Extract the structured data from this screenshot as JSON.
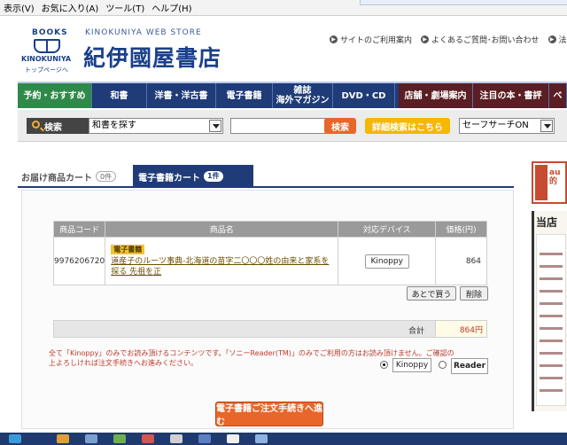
{
  "browser_menu": [
    "表示(V)",
    "お気に入り(A)",
    "ツール(T)",
    "ヘルプ(H)"
  ],
  "logo": {
    "books": "BOOKS",
    "brand": "KINOKUNIYA",
    "top_link": "トップページへ"
  },
  "store": {
    "name_en": "KINOKUNIYA WEB STORE",
    "name_jp": "紀伊國屋書店"
  },
  "header_links": [
    "サイトのご利用案内",
    "よくあるご質問･お問い合わせ",
    "法"
  ],
  "nav": [
    "予約・おすすめ",
    "和書",
    "洋書・洋古書",
    "電子書籍",
    "雑誌\n海外マガジン",
    "DVD・CD",
    "店舗・劇場案内",
    "注目の本・書評",
    "ベ"
  ],
  "search": {
    "label": "検索",
    "category": "和書を探す",
    "query": "",
    "submit": "検索",
    "advanced": "詳細検索はこちら",
    "safe": "セーフサーチON"
  },
  "tabs": {
    "delivery": "お届け商品カート",
    "delivery_count": "0件",
    "ebook": "電子書籍カート",
    "ebook_count": "1件"
  },
  "cart": {
    "headers": {
      "code": "商品コード",
      "name": "商品名",
      "device": "対応デバイス",
      "price": "価格(円)"
    },
    "items": [
      {
        "code": "9976206720",
        "tag": "電子書籍",
        "title": "道産子のルーツ事典-北海道の苗字二〇〇〇姓の由来と家系を探る 先祖を正",
        "device": "Kinoppy",
        "price": "864"
      }
    ],
    "later_button": "あとで買う",
    "delete_button": "削除",
    "total_label": "合計",
    "total_value": "864円"
  },
  "notice": {
    "line1": "全て「Kinoppy」のみでお読み頂けるコンテンツです。「ソニーReader(TM)」のみでご利用の方はお読み頂けません。ご確認の",
    "line2": "上よろしければ注文手続きへお進みください。",
    "opt_kinoppy": "Kinoppy",
    "opt_reader": "Reader"
  },
  "checkout_button": "電子書籍ご注文手続きへ進む",
  "right_ad": {
    "text1": "au的",
    "head": "当店"
  },
  "colors": {
    "navy": "#1f3c78",
    "orange": "#e8662a",
    "yellow": "#f4b800",
    "red": "#c0392b"
  }
}
